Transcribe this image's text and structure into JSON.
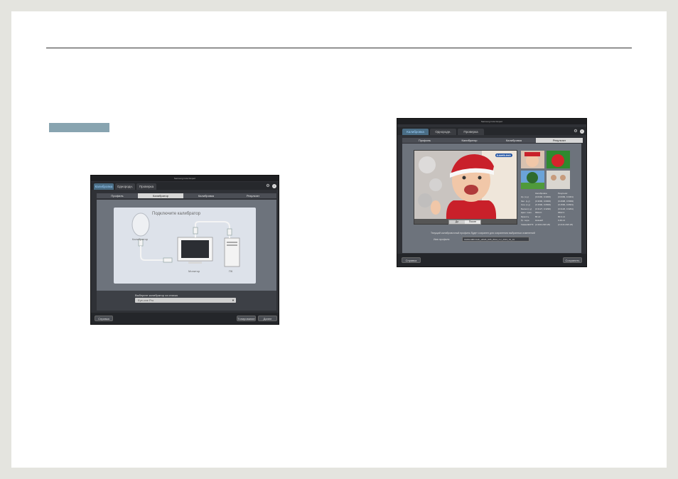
{
  "window_left": {
    "title": "Samsung Color Expert",
    "tabs": [
      "Калибровка",
      "Однородн.",
      "Проверка"
    ],
    "steps": [
      "Профиль",
      "Калибратор",
      "Калибровка",
      "Результат"
    ],
    "panel_heading": "Подключите калибратор",
    "labels": {
      "calibrator": "Калибратор",
      "monitor": "Монитор",
      "pc": "ПК"
    },
    "select_label": "Выберите калибратор из списка",
    "select_value": "Eye-one Pro",
    "buttons": {
      "help": "Справка",
      "back": "Тонирование",
      "next": "Далее"
    }
  },
  "window_right": {
    "title": "Samsung Color Expert",
    "tabs": [
      "Калибровка",
      "Однородн.",
      "Проверка"
    ],
    "steps": [
      "Профиль",
      "Калибратор",
      "Калибровка",
      "Результат"
    ],
    "brand": "SAMSUNG",
    "toggle": [
      "До",
      "После"
    ],
    "stats_headers": [
      "",
      "Калибровка",
      "Результат"
    ],
    "stats_rows": [
      [
        "Кр. (x,y)",
        "(0.6400, 0.3300)",
        "(0.6399, 0.3301)"
      ],
      [
        "Зел. (x,y)",
        "(0.3000, 0.6000)",
        "(0.2998, 0.5999)"
      ],
      [
        "Син. (x,y)",
        "(0.1500, 0.0600)",
        "(0.1500, 0.0601)"
      ],
      [
        "Белая (x,y)",
        "(0.3127, 0.3290)",
        "(0.3126, 0.3291)"
      ],
      [
        "Цвет. темп.",
        "6504 K",
        "6502 K"
      ],
      [
        "Яркость",
        "80 cd",
        "80.0 cd"
      ],
      [
        "Гр. черн.",
        "Нижний",
        "0.49 cd"
      ],
      [
        "Гамма/EOTF",
        "(2.20/2.20/2.20)",
        "(2.21/2.20/2.20)"
      ]
    ],
    "notice": "Текущий калибровочный профиль будет сохранен для сохранения выбранных изменений",
    "profile_label": "Имя профиля",
    "profile_value": "1920x1080 FHD_sRGB_D65_80cd_2.2_2013_01_01",
    "buttons": {
      "help": "Справка",
      "save": "Сохранить"
    }
  }
}
